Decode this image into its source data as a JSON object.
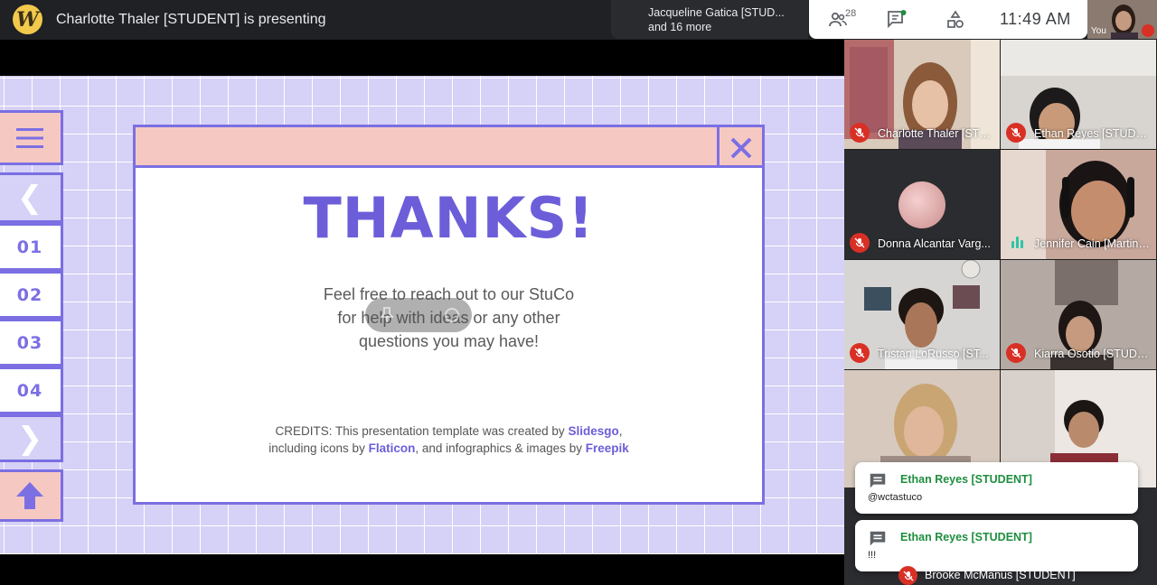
{
  "topbar": {
    "logo_letter": "W",
    "presenting": "Charlotte Thaler [STUDENT] is presenting",
    "joined_line1": "Jacqueline Gatica [STUD...",
    "joined_line2": "and 16 more",
    "people_count": "28",
    "clock": "11:49  AM",
    "self_label": "You"
  },
  "slide": {
    "nav": [
      "01",
      "02",
      "03",
      "04"
    ],
    "title": "THANKS!",
    "body_lines": [
      "Feel free to reach out to our StuCo",
      "for help with ideas or any other",
      "questions you may have!"
    ],
    "credits_line1_pre": "CREDITS: This presentation template was created by ",
    "credits_link1": "Slidesgo",
    "credits_line1_post": ",",
    "credits_line2_pre": "including icons by ",
    "credits_link2": "Flaticon",
    "credits_line2_mid": ", and infographics & images by ",
    "credits_link3": "Freepik"
  },
  "participants": [
    {
      "name": "Charlotte Thaler [STU...",
      "muted": true
    },
    {
      "name": "Ethan Reyes [STUDE...",
      "muted": true
    },
    {
      "name": "Donna Alcantar Varg...",
      "muted": true
    },
    {
      "name": "Jennifer Cain [Martin ...",
      "muted": false
    },
    {
      "name": "Tristan LoRusso [ST...",
      "muted": true
    },
    {
      "name": "Kiarra Osotio [STUDE...",
      "muted": true
    },
    {
      "name": "Brooke McManus [STUDENT]",
      "muted": true
    }
  ],
  "chat_toasts": [
    {
      "sender": "Ethan Reyes [STUDENT]",
      "message": "@wctastuco"
    },
    {
      "sender": "Ethan Reyes [STUDENT]",
      "message": "!!!"
    }
  ],
  "colors": {
    "slide_accent": "#7b6fe3",
    "slide_pink": "#f6c8c2",
    "slide_grid_bg": "#d6d1f6",
    "muted_red": "#d93025",
    "chat_green": "#1e8e3e"
  }
}
